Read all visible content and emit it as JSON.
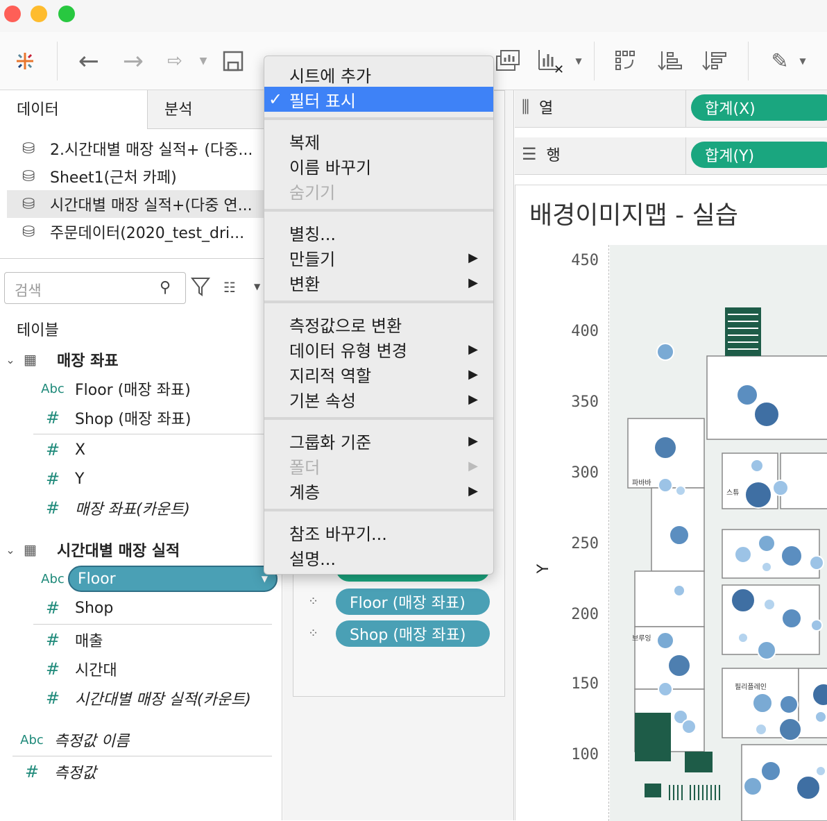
{
  "toolbar": {
    "icons": [
      "tableau-logo-icon",
      "back-icon",
      "forward-icon",
      "redo-icon",
      "dropdown-icon",
      "save-icon",
      "data-source-icon",
      "chart-icon",
      "clear-sheet-icon",
      "swap-icon",
      "sort-asc-icon",
      "sort-desc-icon",
      "highlight-icon"
    ]
  },
  "left_tabs": {
    "data": "데이터",
    "analysis": "분석"
  },
  "datasources": [
    "2.시간대별 매장 실적+ (다중...",
    "Sheet1(근처 카페)",
    "시간대별 매장 실적+(다중 연...",
    "주문데이터(2020_test_dri..."
  ],
  "search": {
    "placeholder": "검색"
  },
  "tables_label": "테이블",
  "table1": {
    "name": "매장 좌표",
    "fields": [
      {
        "type": "Abc",
        "name": "Floor (매장 좌표)"
      },
      {
        "type": "#",
        "name": "Shop (매장 좌표)"
      },
      {
        "type": "#",
        "name": "X"
      },
      {
        "type": "#",
        "name": "Y"
      },
      {
        "type": "#",
        "name": "매장 좌표(카운트)"
      }
    ]
  },
  "table2": {
    "name": "시간대별 매장 실적",
    "fields": [
      {
        "type": "Abc",
        "name": "Floor"
      },
      {
        "type": "#",
        "name": "Shop"
      },
      {
        "type": "#",
        "name": "매출"
      },
      {
        "type": "#",
        "name": "시간대"
      },
      {
        "type": "#",
        "name": "시간대별 매장 실적(카운트)"
      }
    ]
  },
  "measure_names": {
    "type": "Abc",
    "name": "측정값 이름"
  },
  "measure_values": {
    "type": "#",
    "name": "측정값"
  },
  "marks_pills": [
    "Floor (매장 좌표)",
    "Shop (매장 좌표)"
  ],
  "columns_shelf": {
    "label": "열",
    "pill": "합계(X)"
  },
  "rows_shelf": {
    "label": "행",
    "pill": "합계(Y)"
  },
  "viz": {
    "title": "배경이미지맵 - 실습",
    "y_axis_label": "Y",
    "y_ticks": [
      "450",
      "400",
      "350",
      "300",
      "250",
      "200",
      "150",
      "100"
    ]
  },
  "context_menu": {
    "items": [
      {
        "label": "시트에 추가"
      },
      {
        "label": "필터 표시",
        "checked": "✓"
      },
      {
        "label": "복제"
      },
      {
        "label": "이름 바꾸기"
      },
      {
        "label": "숨기기"
      },
      {
        "label": "별칭..."
      },
      {
        "label": "만들기"
      },
      {
        "label": "변환"
      },
      {
        "label": "측정값으로 변환"
      },
      {
        "label": "데이터 유형 변경"
      },
      {
        "label": "지리적 역할"
      },
      {
        "label": "기본 속성"
      },
      {
        "label": "그룹화 기준"
      },
      {
        "label": "폴더"
      },
      {
        "label": "계층"
      },
      {
        "label": "참조 바꾸기..."
      },
      {
        "label": "설명..."
      }
    ]
  },
  "colors": {
    "highlight": "#3e82f7",
    "pill_dimension": "#4aa0b5",
    "pill_measure": "#1aa67f",
    "mark": "#4e7fb0"
  }
}
